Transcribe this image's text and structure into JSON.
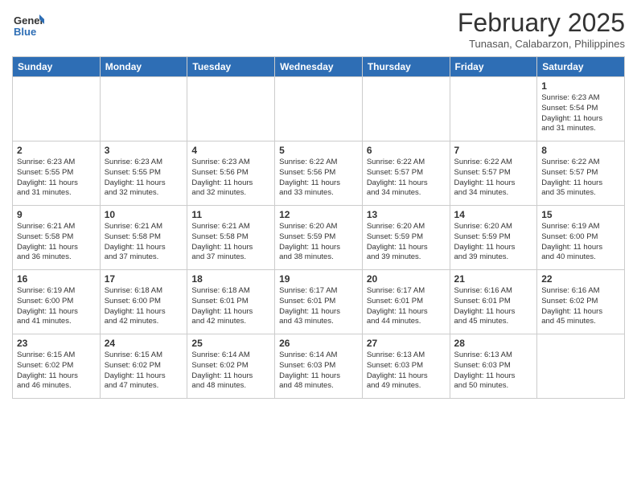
{
  "header": {
    "title": "February 2025",
    "location": "Tunasan, Calabarzon, Philippines"
  },
  "columns": [
    "Sunday",
    "Monday",
    "Tuesday",
    "Wednesday",
    "Thursday",
    "Friday",
    "Saturday"
  ],
  "weeks": [
    [
      {
        "day": "",
        "info": ""
      },
      {
        "day": "",
        "info": ""
      },
      {
        "day": "",
        "info": ""
      },
      {
        "day": "",
        "info": ""
      },
      {
        "day": "",
        "info": ""
      },
      {
        "day": "",
        "info": ""
      },
      {
        "day": "1",
        "info": "Sunrise: 6:23 AM\nSunset: 5:54 PM\nDaylight: 11 hours\nand 31 minutes."
      }
    ],
    [
      {
        "day": "2",
        "info": "Sunrise: 6:23 AM\nSunset: 5:55 PM\nDaylight: 11 hours\nand 31 minutes."
      },
      {
        "day": "3",
        "info": "Sunrise: 6:23 AM\nSunset: 5:55 PM\nDaylight: 11 hours\nand 32 minutes."
      },
      {
        "day": "4",
        "info": "Sunrise: 6:23 AM\nSunset: 5:56 PM\nDaylight: 11 hours\nand 32 minutes."
      },
      {
        "day": "5",
        "info": "Sunrise: 6:22 AM\nSunset: 5:56 PM\nDaylight: 11 hours\nand 33 minutes."
      },
      {
        "day": "6",
        "info": "Sunrise: 6:22 AM\nSunset: 5:57 PM\nDaylight: 11 hours\nand 34 minutes."
      },
      {
        "day": "7",
        "info": "Sunrise: 6:22 AM\nSunset: 5:57 PM\nDaylight: 11 hours\nand 34 minutes."
      },
      {
        "day": "8",
        "info": "Sunrise: 6:22 AM\nSunset: 5:57 PM\nDaylight: 11 hours\nand 35 minutes."
      }
    ],
    [
      {
        "day": "9",
        "info": "Sunrise: 6:21 AM\nSunset: 5:58 PM\nDaylight: 11 hours\nand 36 minutes."
      },
      {
        "day": "10",
        "info": "Sunrise: 6:21 AM\nSunset: 5:58 PM\nDaylight: 11 hours\nand 37 minutes."
      },
      {
        "day": "11",
        "info": "Sunrise: 6:21 AM\nSunset: 5:58 PM\nDaylight: 11 hours\nand 37 minutes."
      },
      {
        "day": "12",
        "info": "Sunrise: 6:20 AM\nSunset: 5:59 PM\nDaylight: 11 hours\nand 38 minutes."
      },
      {
        "day": "13",
        "info": "Sunrise: 6:20 AM\nSunset: 5:59 PM\nDaylight: 11 hours\nand 39 minutes."
      },
      {
        "day": "14",
        "info": "Sunrise: 6:20 AM\nSunset: 5:59 PM\nDaylight: 11 hours\nand 39 minutes."
      },
      {
        "day": "15",
        "info": "Sunrise: 6:19 AM\nSunset: 6:00 PM\nDaylight: 11 hours\nand 40 minutes."
      }
    ],
    [
      {
        "day": "16",
        "info": "Sunrise: 6:19 AM\nSunset: 6:00 PM\nDaylight: 11 hours\nand 41 minutes."
      },
      {
        "day": "17",
        "info": "Sunrise: 6:18 AM\nSunset: 6:00 PM\nDaylight: 11 hours\nand 42 minutes."
      },
      {
        "day": "18",
        "info": "Sunrise: 6:18 AM\nSunset: 6:01 PM\nDaylight: 11 hours\nand 42 minutes."
      },
      {
        "day": "19",
        "info": "Sunrise: 6:17 AM\nSunset: 6:01 PM\nDaylight: 11 hours\nand 43 minutes."
      },
      {
        "day": "20",
        "info": "Sunrise: 6:17 AM\nSunset: 6:01 PM\nDaylight: 11 hours\nand 44 minutes."
      },
      {
        "day": "21",
        "info": "Sunrise: 6:16 AM\nSunset: 6:01 PM\nDaylight: 11 hours\nand 45 minutes."
      },
      {
        "day": "22",
        "info": "Sunrise: 6:16 AM\nSunset: 6:02 PM\nDaylight: 11 hours\nand 45 minutes."
      }
    ],
    [
      {
        "day": "23",
        "info": "Sunrise: 6:15 AM\nSunset: 6:02 PM\nDaylight: 11 hours\nand 46 minutes."
      },
      {
        "day": "24",
        "info": "Sunrise: 6:15 AM\nSunset: 6:02 PM\nDaylight: 11 hours\nand 47 minutes."
      },
      {
        "day": "25",
        "info": "Sunrise: 6:14 AM\nSunset: 6:02 PM\nDaylight: 11 hours\nand 48 minutes."
      },
      {
        "day": "26",
        "info": "Sunrise: 6:14 AM\nSunset: 6:03 PM\nDaylight: 11 hours\nand 48 minutes."
      },
      {
        "day": "27",
        "info": "Sunrise: 6:13 AM\nSunset: 6:03 PM\nDaylight: 11 hours\nand 49 minutes."
      },
      {
        "day": "28",
        "info": "Sunrise: 6:13 AM\nSunset: 6:03 PM\nDaylight: 11 hours\nand 50 minutes."
      },
      {
        "day": "",
        "info": ""
      }
    ]
  ]
}
